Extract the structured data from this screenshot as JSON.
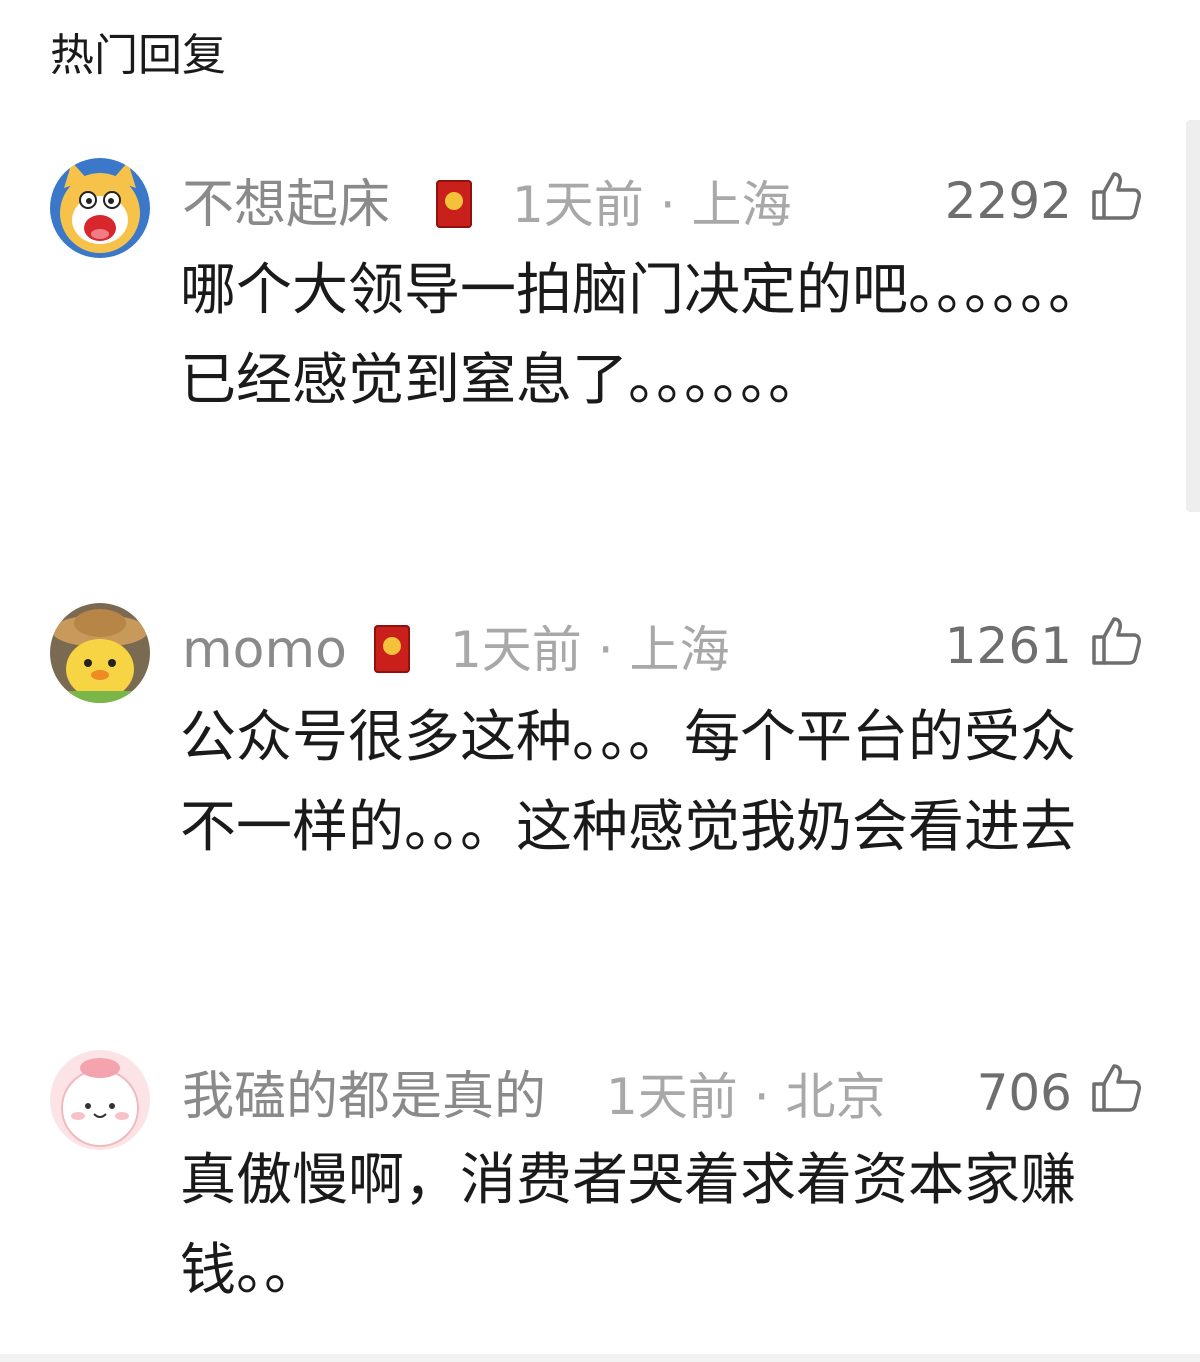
{
  "section": {
    "title": "热门回复"
  },
  "comments": [
    {
      "user": "不想起床",
      "avatar_icon": "cartoon-cat-avatar-icon",
      "badge_icon": "red-envelope-badge-icon",
      "meta": "1天前 · 上海",
      "likes": "2292",
      "text": "哪个大领导一拍脑门决定的吧。。。。。。已经感觉到窒息了。。。。。。"
    },
    {
      "user": "momo",
      "avatar_icon": "yellow-chick-avatar-icon",
      "badge_icon": "red-envelope-badge-icon",
      "meta": "1天前 · 上海",
      "likes": "1261",
      "text": "公众号很多这种。。。每个平台的受众不一样的。。。这种感觉我奶会看进去"
    },
    {
      "user": "我磕的都是真的",
      "avatar_icon": "pink-blob-avatar-icon",
      "meta": "1天前 · 北京",
      "likes": "706",
      "text": "真傲慢啊，消费者哭着求着资本家赚钱。。"
    }
  ],
  "colors": {
    "name": "#8a8a8a",
    "meta": "#a8a8a8",
    "text": "#1a1a1a",
    "badge": "#c9201c"
  }
}
